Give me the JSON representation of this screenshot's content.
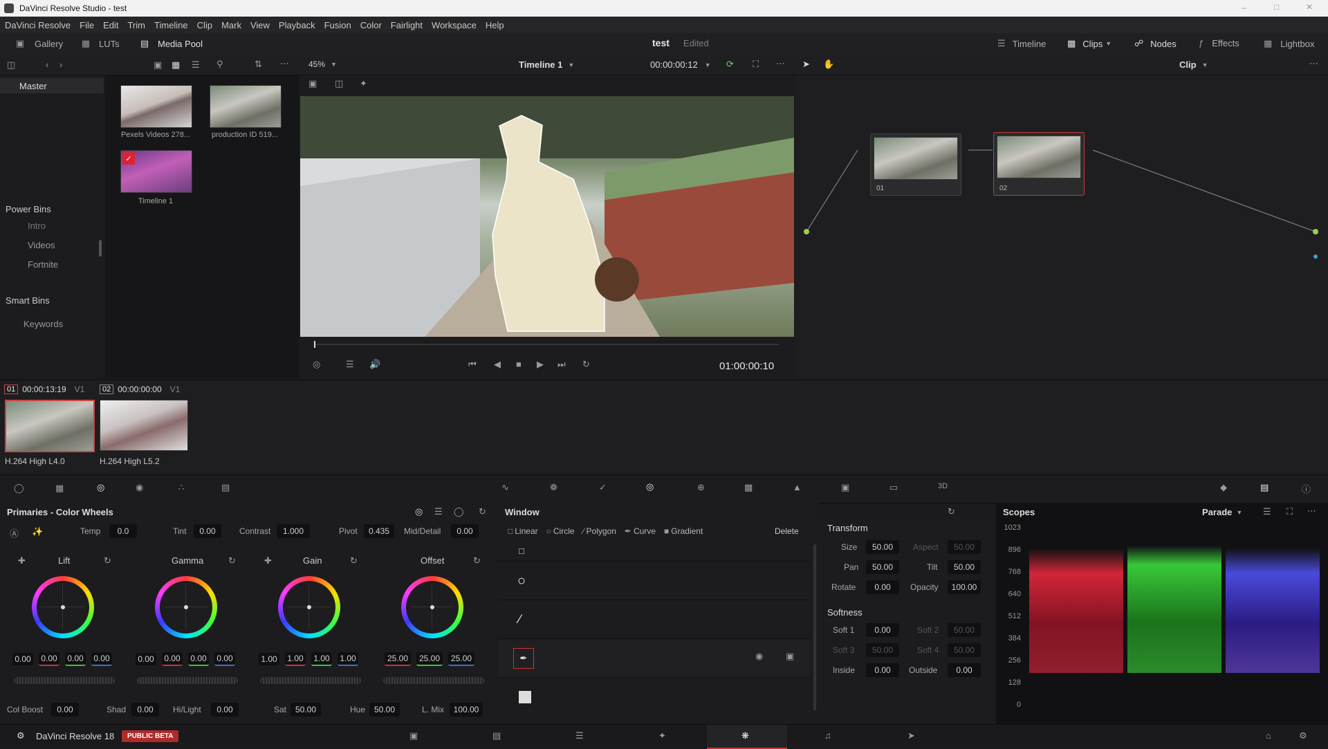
{
  "window": {
    "title": "DaVinci Resolve Studio - test"
  },
  "menu": [
    "DaVinci Resolve",
    "File",
    "Edit",
    "Trim",
    "Timeline",
    "Clip",
    "Mark",
    "View",
    "Playback",
    "Fusion",
    "Color",
    "Fairlight",
    "Workspace",
    "Help"
  ],
  "toolbar": {
    "gallery": "Gallery",
    "luts": "LUTs",
    "media_pool": "Media Pool",
    "project": "test",
    "status": "Edited",
    "timeline": "Timeline",
    "clips": "Clips",
    "nodes": "Nodes",
    "effects": "Effects",
    "lightbox": "Lightbox"
  },
  "viewer": {
    "zoom": "45%",
    "timeline_name": "Timeline 1",
    "timecode": "00:00:00:12",
    "playhead_tc": "01:00:00:10"
  },
  "nodes_mode": "Clip",
  "sidebar": {
    "master": "Master",
    "power_bins": "Power Bins",
    "power_items": [
      "Intro",
      "Videos",
      "Fortnite"
    ],
    "smart_bins": "Smart Bins",
    "smart_items": [
      "Keywords"
    ]
  },
  "media": [
    {
      "label": "Pexels Videos 278..."
    },
    {
      "label": "production ID 519..."
    },
    {
      "label": "Timeline 1"
    }
  ],
  "node_labels": [
    "01",
    "02"
  ],
  "clips": [
    {
      "num": "01",
      "tc": "00:00:13:19",
      "track": "V1",
      "codec": "H.264 High L4.0"
    },
    {
      "num": "02",
      "tc": "00:00:00:00",
      "track": "V1",
      "codec": "H.264 High L5.2"
    }
  ],
  "primaries": {
    "title": "Primaries - Color Wheels",
    "temp_label": "Temp",
    "temp": "0.0",
    "tint_label": "Tint",
    "tint": "0.00",
    "contrast_label": "Contrast",
    "contrast": "1.000",
    "pivot_label": "Pivot",
    "pivot": "0.435",
    "middetail_label": "Mid/Detail",
    "middetail": "0.00",
    "wheels": [
      {
        "name": "Lift",
        "vals": [
          "0.00",
          "0.00",
          "0.00",
          "0.00"
        ]
      },
      {
        "name": "Gamma",
        "vals": [
          "0.00",
          "0.00",
          "0.00",
          "0.00"
        ]
      },
      {
        "name": "Gain",
        "vals": [
          "1.00",
          "1.00",
          "1.00",
          "1.00"
        ]
      },
      {
        "name": "Offset",
        "vals": [
          "25.00",
          "25.00",
          "25.00"
        ]
      }
    ],
    "colboost_label": "Col Boost",
    "colboost": "0.00",
    "shad_label": "Shad",
    "shad": "0.00",
    "hilight_label": "Hi/Light",
    "hilight": "0.00",
    "sat_label": "Sat",
    "sat": "50.00",
    "hue_label": "Hue",
    "hue": "50.00",
    "lmix_label": "L. Mix",
    "lmix": "100.00"
  },
  "window_panel": {
    "title": "Window",
    "tools": [
      "Linear",
      "Circle",
      "Polygon",
      "Curve",
      "Gradient"
    ],
    "delete": "Delete"
  },
  "transform": {
    "title": "Transform",
    "size_label": "Size",
    "size": "50.00",
    "aspect_label": "Aspect",
    "aspect": "50.00",
    "pan_label": "Pan",
    "pan": "50.00",
    "tilt_label": "Tilt",
    "tilt": "50.00",
    "rotate_label": "Rotate",
    "rotate": "0.00",
    "opacity_label": "Opacity",
    "opacity": "100.00",
    "softness_title": "Softness",
    "soft1_label": "Soft 1",
    "soft1": "0.00",
    "soft2_label": "Soft 2",
    "soft2": "50.00",
    "soft3_label": "Soft 3",
    "soft3": "50.00",
    "soft4_label": "Soft 4",
    "soft4": "50.00",
    "inside_label": "Inside",
    "inside": "0.00",
    "outside_label": "Outside",
    "outside": "0.00"
  },
  "scopes": {
    "title": "Scopes",
    "mode": "Parade",
    "ticks": [
      "1023",
      "896",
      "768",
      "640",
      "512",
      "384",
      "256",
      "128",
      "0"
    ]
  },
  "footer": {
    "app": "DaVinci Resolve 18",
    "badge": "PUBLIC BETA"
  }
}
